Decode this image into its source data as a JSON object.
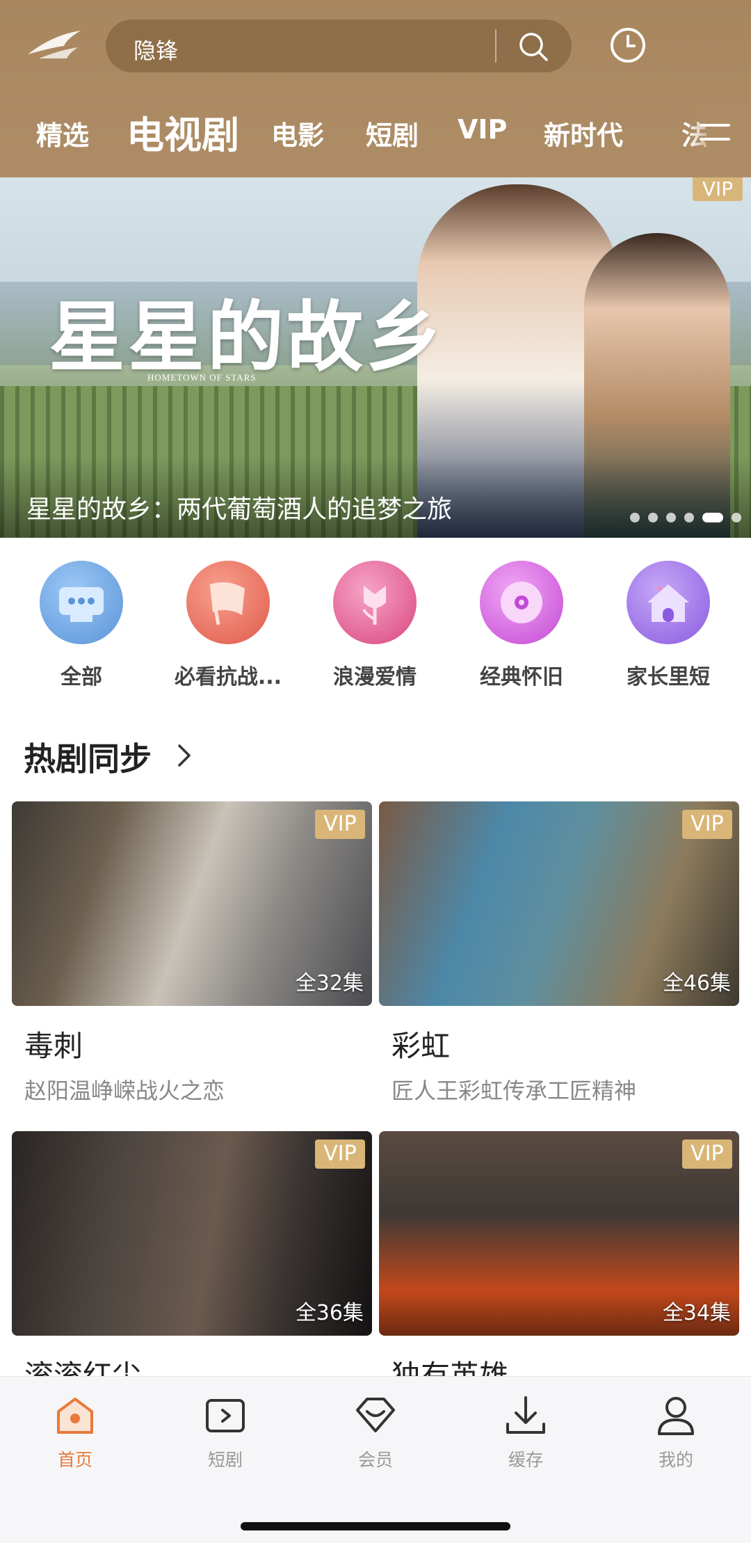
{
  "header": {
    "search_placeholder": "隐锋",
    "tabs": [
      {
        "label": "精选"
      },
      {
        "label": "电视剧",
        "active": true
      },
      {
        "label": "电影"
      },
      {
        "label": "短剧"
      },
      {
        "label": "VIP"
      },
      {
        "label": "新时代"
      },
      {
        "label": "法"
      }
    ]
  },
  "banner": {
    "title_art": "星星的故乡",
    "title_art_en": "HOMETOWN OF STARS",
    "vip_badge": "VIP",
    "caption": "星星的故乡：两代葡萄酒人的追梦之旅",
    "dot_count": 6,
    "active_dot": 5
  },
  "categories": [
    {
      "label": "全部"
    },
    {
      "label": "必看抗战..."
    },
    {
      "label": "浪漫爱情"
    },
    {
      "label": "经典怀旧"
    },
    {
      "label": "家长里短"
    }
  ],
  "section": {
    "title": "热剧同步",
    "cards": [
      {
        "vip": "VIP",
        "episodes": "全32集",
        "name": "毒刺",
        "desc": "赵阳温峥嵘战火之恋"
      },
      {
        "vip": "VIP",
        "episodes": "全46集",
        "name": "彩虹",
        "desc": "匠人王彩虹传承工匠精神"
      },
      {
        "vip": "VIP",
        "episodes": "全36集",
        "name": "滚滚红尘",
        "desc": ""
      },
      {
        "vip": "VIP",
        "episodes": "全34集",
        "name": "独有英雄",
        "desc": ""
      }
    ]
  },
  "bottom_nav": [
    {
      "label": "首页",
      "active": true
    },
    {
      "label": "短剧"
    },
    {
      "label": "会员"
    },
    {
      "label": "缓存"
    },
    {
      "label": "我的"
    }
  ],
  "colors": {
    "header_bg": "#ae8d66",
    "vip_gold": "#d9b678",
    "active_nav": "#e87a3b"
  }
}
